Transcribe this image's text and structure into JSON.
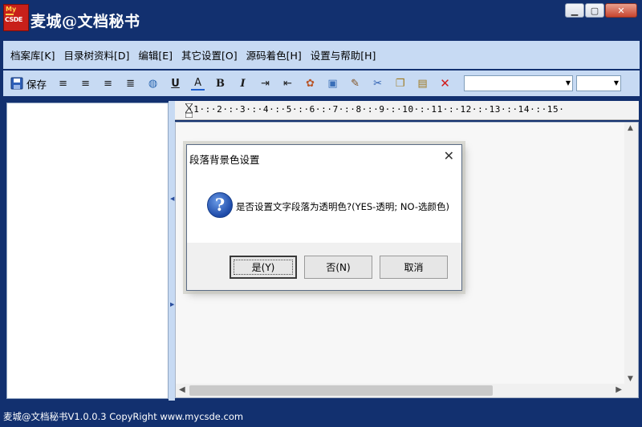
{
  "app": {
    "title": "麦城@文档秘书",
    "logo_top": "My",
    "logo_bottom": "CSDE"
  },
  "window_buttons": {
    "minimize": "▁",
    "maximize": "▢",
    "close": "✕"
  },
  "menu": {
    "items": [
      "档案库[K]",
      "目录树资料[D]",
      "编辑[E]",
      "其它设置[O]",
      "源码着色[H]",
      "设置与帮助[H]"
    ]
  },
  "toolbar": {
    "save_label": "保存",
    "icons": [
      "save-icon",
      "align-left-icon",
      "align-center-icon",
      "align-right-icon",
      "justify-icon",
      "globe-icon",
      "underline-icon",
      "font-color-icon",
      "bold-icon",
      "italic-icon",
      "indent-icon",
      "outdent-icon",
      "paint-icon",
      "image-icon",
      "tool-icon",
      "cut-icon",
      "copy-icon",
      "paste-icon",
      "delete-icon"
    ],
    "glyphs": {
      "align-left": "≡",
      "align-center": "≡",
      "align-right": "≡",
      "justify": "≣",
      "globe": "◍",
      "underline": "U",
      "font-color": "A",
      "bold": "B",
      "italic": "I",
      "indent": "⇥",
      "outdent": "⇤",
      "paint": "✿",
      "image": "▣",
      "tool": "✎",
      "cut": "✂",
      "copy": "❐",
      "paste": "▤",
      "delete": "✕"
    },
    "font_combo": "",
    "size_combo": ""
  },
  "ruler": {
    "text": "·1·:·2·:·3·:·4·:·5·:·6·:·7·:·8·:·9·:·10·:·11·:·12·:·13·:·14·:·15·"
  },
  "dialog": {
    "title": "段落背景色设置",
    "close": "✕",
    "icon_glyph": "?",
    "message": "是否设置文字段落为透明色?(YES-透明; NO-选颜色)",
    "buttons": {
      "yes": "是(Y)",
      "no": "否(N)",
      "cancel": "取消"
    }
  },
  "status": {
    "text": "麦城@文档秘书V1.0.0.3  CopyRight www.mycsde.com"
  },
  "colors": {
    "frame": "#12306f",
    "panel": "#c7daf3",
    "close_button": "#c7452f"
  }
}
